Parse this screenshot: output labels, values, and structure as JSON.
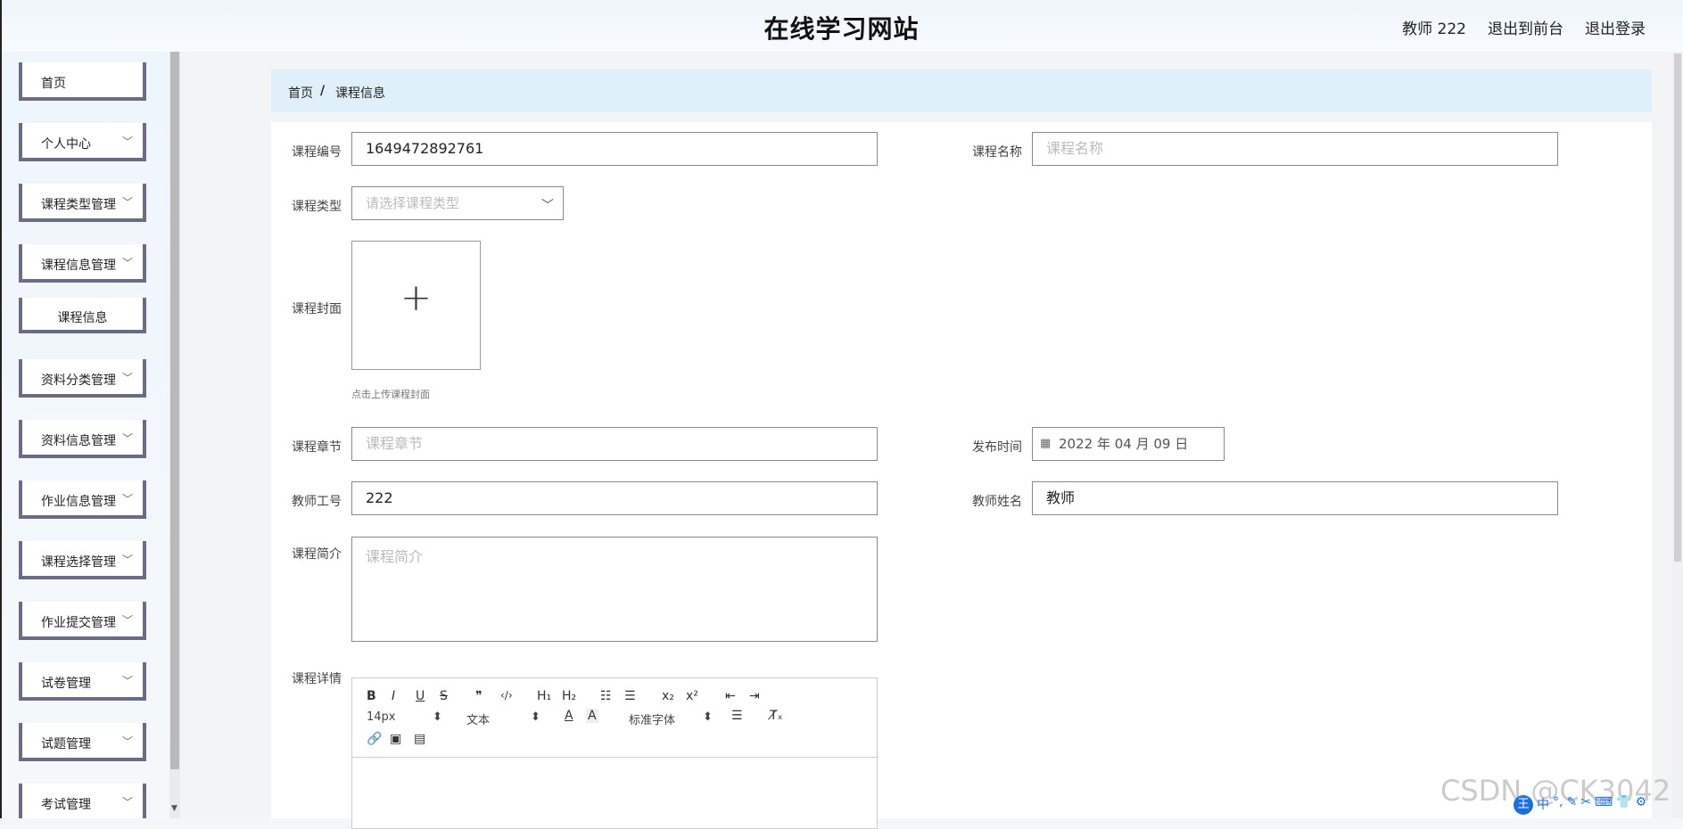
{
  "header": {
    "title": "在线学习网站",
    "user": "教师 222",
    "back_to_front": "退出到前台",
    "logout": "退出登录"
  },
  "sidebar": {
    "items": [
      {
        "label": "首页",
        "chevron": ""
      },
      {
        "label": "个人中心",
        "chevron": "﹀"
      },
      {
        "label": "课程类型管理",
        "chevron": "﹀"
      },
      {
        "label": "课程信息管理",
        "chevron": "﹀"
      },
      {
        "label": "课程信息",
        "chevron": ""
      },
      {
        "label": "资料分类管理",
        "chevron": "﹀"
      },
      {
        "label": "资料信息管理",
        "chevron": "﹀"
      },
      {
        "label": "作业信息管理",
        "chevron": "﹀"
      },
      {
        "label": "课程选择管理",
        "chevron": "﹀"
      },
      {
        "label": "作业提交管理",
        "chevron": "﹀"
      },
      {
        "label": "试卷管理",
        "chevron": "﹀"
      },
      {
        "label": "试题管理",
        "chevron": "﹀"
      },
      {
        "label": "考试管理",
        "chevron": "﹀"
      }
    ]
  },
  "breadcrumb": {
    "home": "首页",
    "sep": "/",
    "current": "课程信息"
  },
  "form": {
    "course_no_label": "课程编号",
    "course_no_value": "1649472892761",
    "course_name_label": "课程名称",
    "course_name_placeholder": "课程名称",
    "course_type_label": "课程类型",
    "course_type_placeholder": "请选择课程类型",
    "cover_label": "课程封面",
    "cover_plus": "+",
    "cover_hint": "点击上传课程封面",
    "chapter_label": "课程章节",
    "chapter_placeholder": "课程章节",
    "publish_label": "发布时间",
    "publish_value": "2022 年 04 月 09 日",
    "teacher_no_label": "教师工号",
    "teacher_no_value": "222",
    "teacher_name_label": "教师姓名",
    "teacher_name_value": "教师",
    "intro_label": "课程简介",
    "intro_placeholder": "课程简介",
    "detail_label": "课程详情"
  },
  "editor_toolbar": {
    "bold": "B",
    "italic": "I",
    "underline": "U",
    "strike": "S",
    "quote": "❞",
    "code": "‹/›",
    "h1": "H₁",
    "h2": "H₂",
    "ol": "☷",
    "ul": "☰",
    "sub": "x₂",
    "sup": "x²",
    "outdent": "⇤",
    "indent": "⇥",
    "size": "14px",
    "header": "文本",
    "font": "标准字体",
    "clean": "T̸ₓ"
  },
  "watermark": "CSDN @CK3042",
  "ime": {
    "logo": "王",
    "mode": "中"
  }
}
